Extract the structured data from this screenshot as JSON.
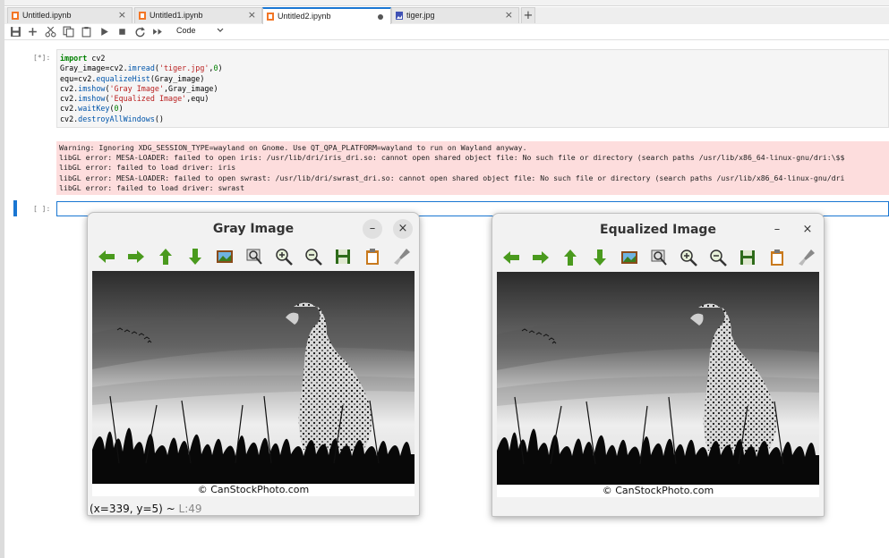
{
  "tabs": [
    {
      "label": "Untitled.ipynb",
      "icon": "notebook-icon",
      "state": "close"
    },
    {
      "label": "Untitled1.ipynb",
      "icon": "notebook-icon",
      "state": "close"
    },
    {
      "label": "Untitled2.ipynb",
      "icon": "notebook-icon",
      "state": "modified"
    },
    {
      "label": "tiger.jpg",
      "icon": "image-file-icon",
      "state": "close"
    }
  ],
  "tab_close_glyph": "×",
  "add_tab_glyph": "+",
  "toolbar": {
    "icons": [
      "save-icon",
      "add-cell-icon",
      "cut-icon",
      "copy-icon",
      "paste-icon",
      "run-icon",
      "stop-icon",
      "restart-icon",
      "run-all-icon"
    ],
    "cell_type": "Code"
  },
  "cells": [
    {
      "prompt": "[*]:",
      "code": [
        "import cv2",
        "Gray_image=cv2.imread('tiger.jpg',0)",
        "equ=cv2.equalizeHist(Gray_image)",
        "cv2.imshow('Gray Image',Gray_image)",
        "cv2.imshow('Equalized Image',equ)",
        "cv2.waitKey(0)",
        "cv2.destroyAllWindows()"
      ],
      "output": [
        "Warning: Ignoring XDG_SESSION_TYPE=wayland on Gnome. Use QT_QPA_PLATFORM=wayland to run on Wayland anyway.",
        "libGL error: MESA-LOADER: failed to open iris: /usr/lib/dri/iris_dri.so: cannot open shared object file: No such file or directory (search paths /usr/lib/x86_64-linux-gnu/dri:\\$$",
        "libGL error: failed to load driver: iris",
        "libGL error: MESA-LOADER: failed to open swrast: /usr/lib/dri/swrast_dri.so: cannot open shared object file: No such file or directory (search paths /usr/lib/x86_64-linux-gnu/dri",
        "libGL error: failed to load driver: swrast"
      ]
    },
    {
      "prompt": "[ ]:",
      "code": []
    }
  ],
  "windows": [
    {
      "title": "Gray Image",
      "minimize": "–",
      "close": "×",
      "caption": "© CanStockPhoto.com",
      "status": "(x=339, y=5) ~",
      "status_level": "L:49"
    },
    {
      "title": "Equalized Image",
      "minimize": "–",
      "close": "×",
      "caption": "© CanStockPhoto.com"
    }
  ],
  "window_toolbar_icons": [
    "arrow-left-icon",
    "arrow-right-icon",
    "arrow-up-icon",
    "arrow-down-icon",
    "image-icon",
    "zoom-region-icon",
    "zoom-in-icon",
    "zoom-out-icon",
    "save-image-icon",
    "copy-image-icon",
    "properties-icon"
  ]
}
